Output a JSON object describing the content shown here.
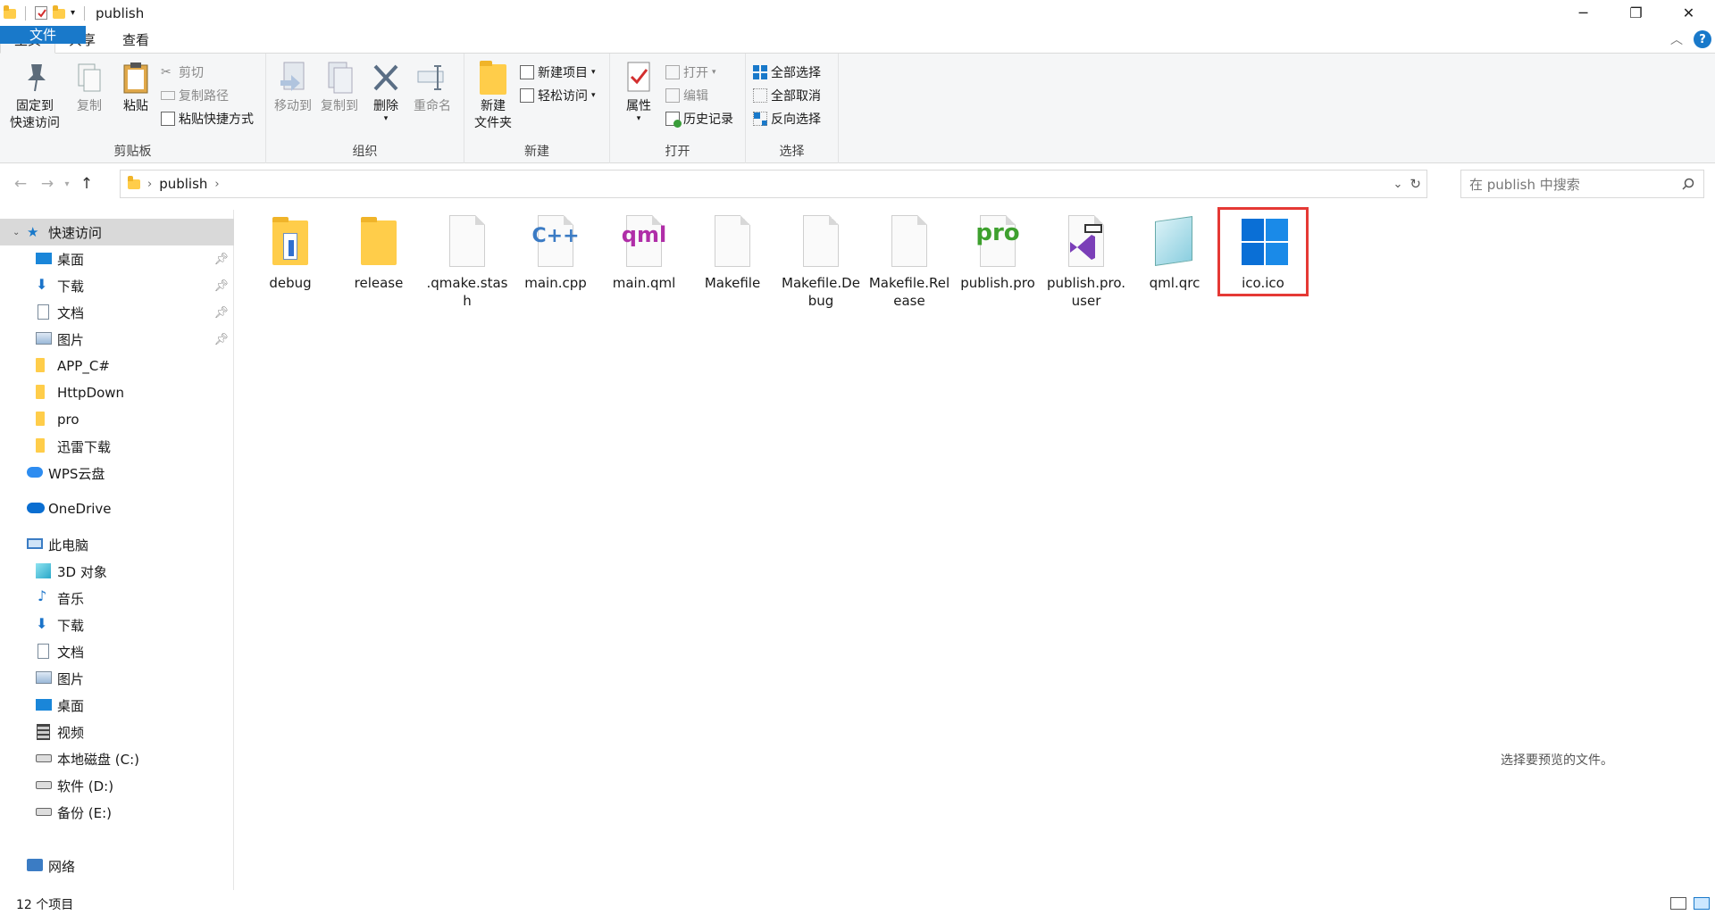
{
  "window": {
    "title": "publish"
  },
  "tabs": {
    "file": "文件",
    "home": "主页",
    "share": "共享",
    "view": "查看"
  },
  "ribbon": {
    "clipboard": {
      "label": "剪贴板",
      "pin": [
        "固定到",
        "快速访问"
      ],
      "copy": "复制",
      "paste": "粘贴",
      "cut": "剪切",
      "copy_path": "复制路径",
      "paste_shortcut": "粘贴快捷方式"
    },
    "organize": {
      "label": "组织",
      "move_to": "移动到",
      "copy_to": "复制到",
      "delete": "删除",
      "rename": "重命名"
    },
    "new": {
      "label": "新建",
      "new_folder": [
        "新建",
        "文件夹"
      ],
      "new_item": "新建项目",
      "easy_access": "轻松访问"
    },
    "open": {
      "label": "打开",
      "properties": "属性",
      "open": "打开",
      "edit": "编辑",
      "history": "历史记录"
    },
    "select": {
      "label": "选择",
      "select_all": "全部选择",
      "select_none": "全部取消",
      "invert": "反向选择"
    }
  },
  "address": {
    "path": "publish",
    "search_placeholder": "在 publish 中搜索"
  },
  "sidebar": {
    "quick_access": "快速访问",
    "quick_items": [
      {
        "label": "桌面",
        "pinned": true
      },
      {
        "label": "下载",
        "pinned": true
      },
      {
        "label": "文档",
        "pinned": true
      },
      {
        "label": "图片",
        "pinned": true
      },
      {
        "label": "APP_C#",
        "pinned": false
      },
      {
        "label": "HttpDown",
        "pinned": false
      },
      {
        "label": "pro",
        "pinned": false
      },
      {
        "label": "迅雷下载",
        "pinned": false
      }
    ],
    "wps": "WPS云盘",
    "onedrive": "OneDrive",
    "this_pc": "此电脑",
    "pc_items": [
      "3D 对象",
      "音乐",
      "下载",
      "文档",
      "图片",
      "桌面",
      "视频",
      "本地磁盘 (C:)",
      "软件 (D:)",
      "备份 (E:)"
    ],
    "network": "网络"
  },
  "files": [
    {
      "name": "debug",
      "type": "folder-doc"
    },
    {
      "name": "release",
      "type": "folder"
    },
    {
      "name": ".qmake.stash",
      "type": "blank"
    },
    {
      "name": "main.cpp",
      "type": "cpp",
      "icon_text": "C++"
    },
    {
      "name": "main.qml",
      "type": "qml",
      "icon_text": "qml"
    },
    {
      "name": "Makefile",
      "type": "blank"
    },
    {
      "name": "Makefile.Debug",
      "type": "blank"
    },
    {
      "name": "Makefile.Release",
      "type": "blank"
    },
    {
      "name": "publish.pro",
      "type": "pro",
      "icon_text": "pro"
    },
    {
      "name": "publish.pro.user",
      "type": "vs"
    },
    {
      "name": "qml.qrc",
      "type": "notepad"
    },
    {
      "name": "ico.ico",
      "type": "windows",
      "highlighted": true
    }
  ],
  "preview_message": "选择要预览的文件。",
  "status": {
    "item_count": "12 个项目"
  },
  "colors": {
    "accent": "#1979ca",
    "highlight_border": "#e53935",
    "selection": "#cde8ff"
  }
}
